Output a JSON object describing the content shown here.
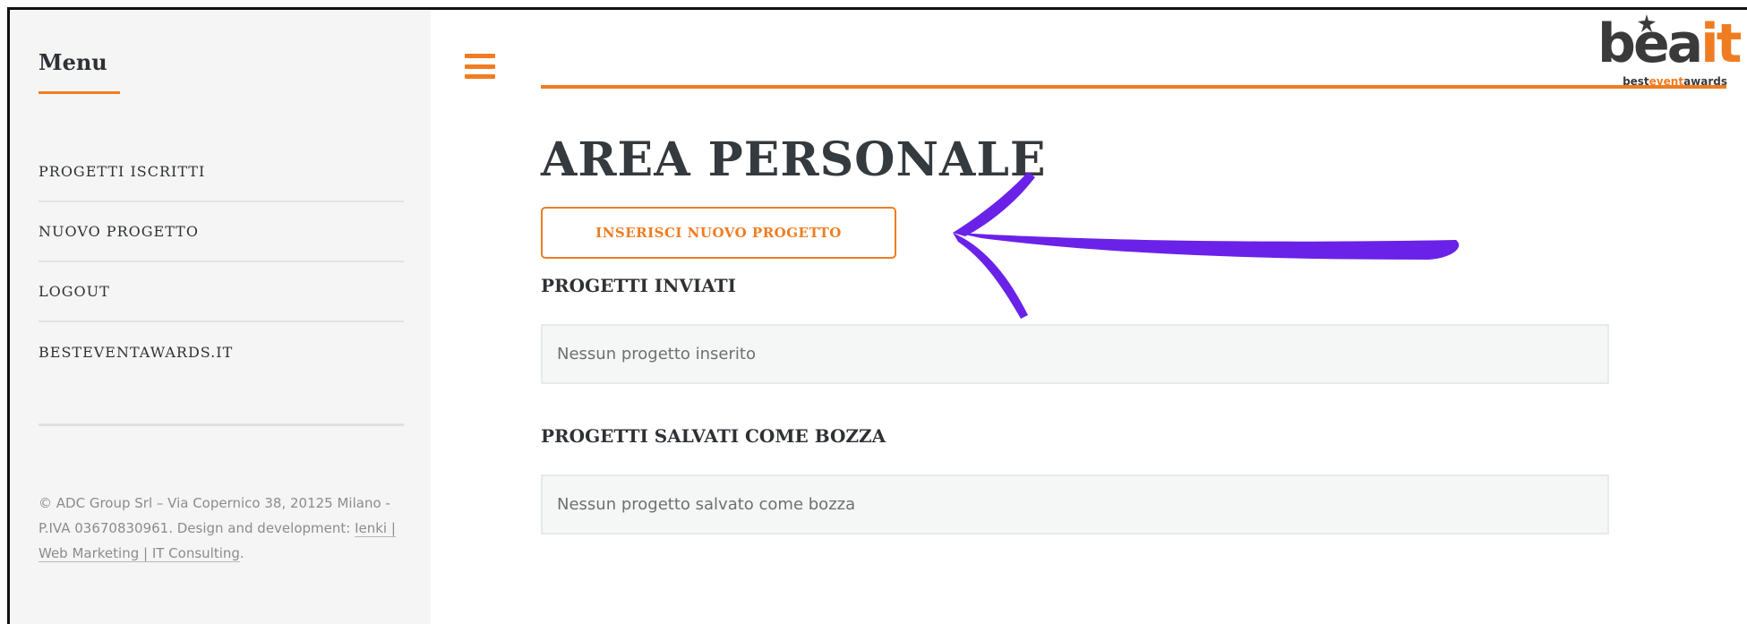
{
  "sidebar": {
    "title": "Menu",
    "items": [
      {
        "label": "PROGETTI ISCRITTI"
      },
      {
        "label": "NUOVO PROGETTO"
      },
      {
        "label": "LOGOUT"
      },
      {
        "label": "BESTEVENTAWARDS.IT"
      }
    ],
    "footer": {
      "text": "© ADC Group Srl – Via Copernico 38, 20125 Milano - P.IVA 03670830961. Design and development: ",
      "link": "Ienki | Web Marketing | IT Consulting",
      "suffix": "."
    }
  },
  "header": {
    "menu_icon": "hamburger-icon",
    "logo": {
      "word_main": "bea",
      "word_accent": "it",
      "tag_pre": "best",
      "tag_accent": "event",
      "tag_post": "awards"
    }
  },
  "main": {
    "title": "AREA PERSONALE",
    "new_button_label": "INSERISCI NUOVO PROGETTO",
    "sections": [
      {
        "title": "PROGETTI INVIATI",
        "empty_text": "Nessun progetto inserito"
      },
      {
        "title": "PROGETTI SALVATI COME BOZZA",
        "empty_text": "Nessun progetto salvato come bozza"
      }
    ]
  },
  "annotation": {
    "icon": "arrow-annotation-icon"
  },
  "colors": {
    "accent": "#f07c22",
    "annotation": "#6a22e8",
    "text_dark": "#2e3135"
  }
}
